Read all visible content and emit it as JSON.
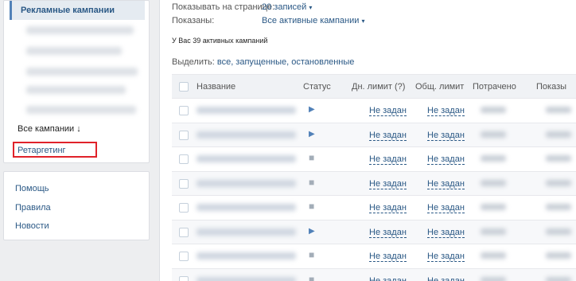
{
  "sidebar": {
    "title": "Рекламные кампании",
    "all_campaigns": "Все кампании ↓",
    "retargeting": "Ретаргетинг",
    "help_links": [
      "Помощь",
      "Правила",
      "Новости"
    ]
  },
  "options": {
    "per_page_label": "Показывать на странице:",
    "per_page_value": "20 записей",
    "show_label": "Показаны:",
    "show_value": "Все активные кампании",
    "dropdown_caret": "▾"
  },
  "active_count": "У Вас 39 активных кампаний",
  "select_prefix": "Выделить: ",
  "select_links": "все, запущенные, остановленные",
  "table": {
    "headers": {
      "name": "Название",
      "status": "Статус",
      "day_limit": "Дн. лимит (?)",
      "total_limit": "Общ. лимит",
      "spent": "Потрачено",
      "impressions": "Показы"
    },
    "limit_text": "Не задан",
    "rows": [
      {
        "status": "running"
      },
      {
        "status": "running"
      },
      {
        "status": "stopped"
      },
      {
        "status": "stopped"
      },
      {
        "status": "stopped"
      },
      {
        "status": "running"
      },
      {
        "status": "stopped"
      },
      {
        "status": "stopped"
      }
    ]
  },
  "colors": {
    "accent": "#2a5885",
    "highlight_border": "#e0222a"
  }
}
